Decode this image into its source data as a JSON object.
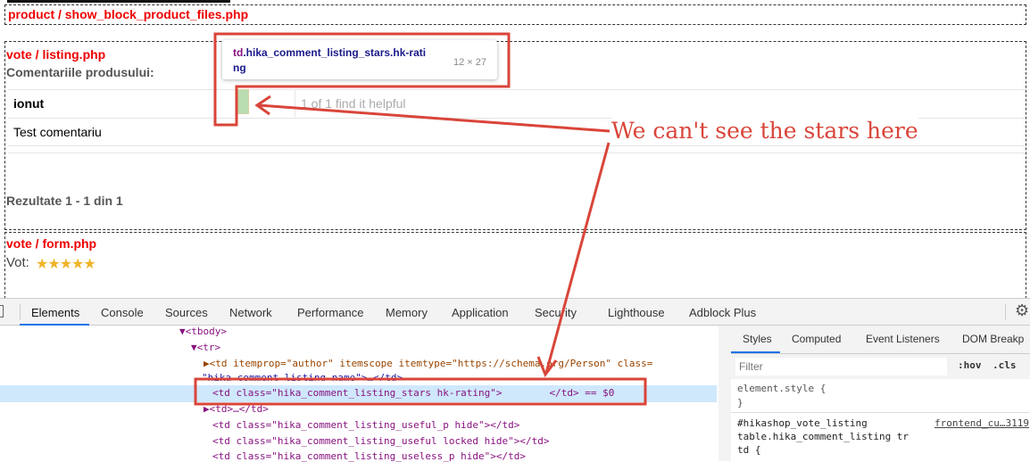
{
  "page": {
    "block1": "product / show_block_product_files.php",
    "block2": "vote / listing.php",
    "comments_heading": "Comentariile produsului:",
    "author": "ionut",
    "helpful": "1 of 1 find it helpful",
    "comment": "Test comentariu",
    "results": "Rezultate 1 - 1 din 1",
    "block3": "vote / form.php",
    "vote_label": "Vot:",
    "vote_stars": 5
  },
  "tooltip": {
    "selector_tag": "td",
    "selector_class": ".hika_comment_listing_stars.hk-rating",
    "size": "12 × 27"
  },
  "annotation": {
    "text": "We can't see the stars here",
    "color": "#d9453a"
  },
  "devtools": {
    "tabs": [
      "Elements",
      "Console",
      "Sources",
      "Network",
      "Performance",
      "Memory",
      "Application",
      "Security",
      "Lighthouse",
      "Adblock Plus"
    ],
    "active_tab": "Elements",
    "side_tabs": [
      "Styles",
      "Computed",
      "Event Listeners",
      "DOM Breakp"
    ],
    "filter_placeholder": "Filter",
    "hov": ":hov",
    "cls": ".cls",
    "element_style": "element.style {",
    "close_brace": "}",
    "rule_selector_1": "#hikashop_vote_listing",
    "rule_selector_2": "table.hika_comment_listing tr",
    "rule_selector_3": "td {",
    "rule_source": "frontend_cu…3119",
    "lines": [
      "▼<tbody>",
      "▼<tr>",
      "▶<td itemprop=\"author\" itemscope itemtype=\"https://schema.org/Person\" class=",
      "\"hika_comment_listing_name\">…</td>",
      "<td class=\"hika_comment_listing_stars hk-rating\">        </td> == $0",
      "▶<td>…</td>",
      "<td class=\"hika_comment_listing_useful_p hide\"></td>",
      "<td class=\"hika_comment_listing_useful locked hide\"></td>",
      "<td class=\"hika_comment_listing_useless_p hide\"></td>"
    ]
  }
}
